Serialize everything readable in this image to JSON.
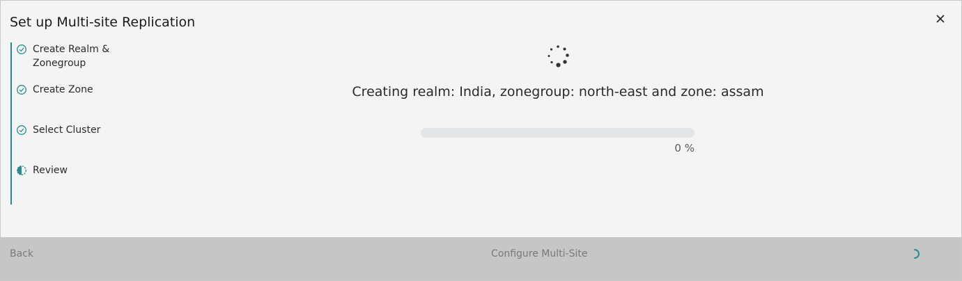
{
  "modal": {
    "title": "Set up Multi-site Replication",
    "close_icon": "close-icon"
  },
  "stepper": {
    "accent_color": "#2a8b8e",
    "steps": [
      {
        "label": "Create Realm & Zonegroup",
        "state": "completed",
        "icon": "check-circle-icon"
      },
      {
        "label": "Create Zone",
        "state": "completed",
        "icon": "check-circle-icon"
      },
      {
        "label": "Select Cluster",
        "state": "completed",
        "icon": "check-circle-icon"
      },
      {
        "label": "Review",
        "state": "in-progress",
        "icon": "half-circle-icon"
      }
    ]
  },
  "status": {
    "spinner_icon": "loading-spinner-icon",
    "message": "Creating realm: India, zonegroup: north-east and zone: assam",
    "progress_percent": 0,
    "progress_text": "0 %"
  },
  "footer": {
    "back_label": "Back",
    "configure_label": "Configure Multi-Site",
    "busy_icon": "loading-arc-icon"
  }
}
